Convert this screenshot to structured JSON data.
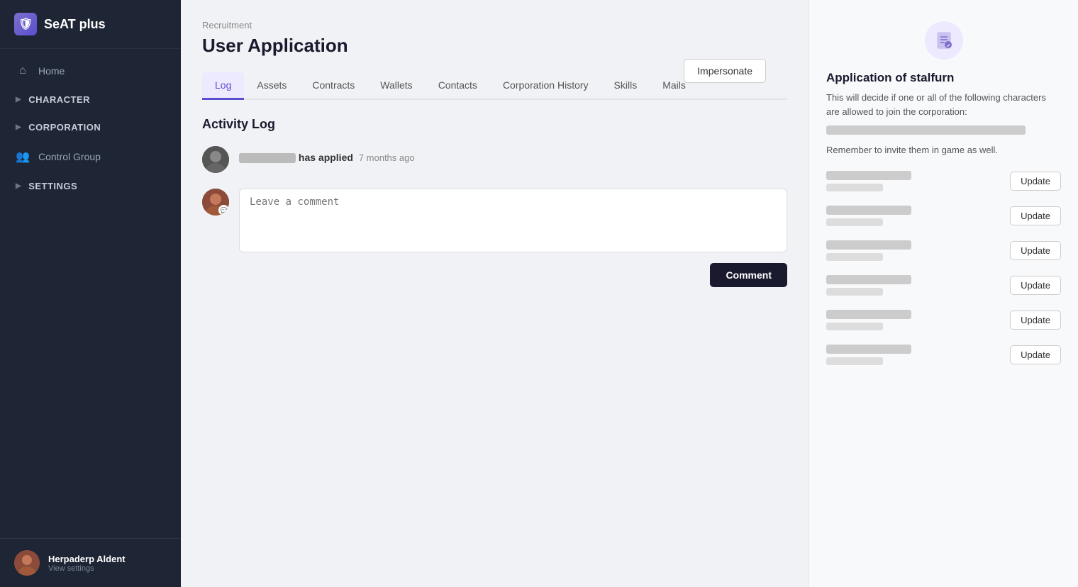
{
  "app": {
    "name": "SeAT plus",
    "logo_icon": "🛡"
  },
  "sidebar": {
    "nav_items": [
      {
        "id": "home",
        "label": "Home",
        "icon": "⌂",
        "type": "link"
      },
      {
        "id": "character",
        "label": "CHARACTER",
        "icon": "▶",
        "type": "section"
      },
      {
        "id": "corporation",
        "label": "CORPORATION",
        "icon": "▶",
        "type": "section"
      },
      {
        "id": "control_group",
        "label": "Control Group",
        "icon": "👥",
        "type": "link"
      },
      {
        "id": "settings",
        "label": "SETTINGS",
        "icon": "▶",
        "type": "section"
      }
    ],
    "footer": {
      "username": "Herpaderp Aldent",
      "view_settings": "View settings"
    }
  },
  "breadcrumb": "Recruitment",
  "page_title": "User Application",
  "impersonate_label": "Impersonate",
  "tabs": [
    {
      "id": "log",
      "label": "Log",
      "active": true
    },
    {
      "id": "assets",
      "label": "Assets",
      "active": false
    },
    {
      "id": "contracts",
      "label": "Contracts",
      "active": false
    },
    {
      "id": "wallets",
      "label": "Wallets",
      "active": false
    },
    {
      "id": "contacts",
      "label": "Contacts",
      "active": false
    },
    {
      "id": "corporation_history",
      "label": "Corporation History",
      "active": false
    },
    {
      "id": "skills",
      "label": "Skills",
      "active": false
    },
    {
      "id": "mails",
      "label": "Mails",
      "active": false
    }
  ],
  "activity_log": {
    "section_title": "Activity Log",
    "entries": [
      {
        "id": 1,
        "user_blurred": true,
        "action": "has applied",
        "time": "7 months ago"
      }
    ]
  },
  "comment": {
    "placeholder": "Leave a comment",
    "submit_label": "Comment"
  },
  "right_panel": {
    "title": "Application of stalfurn",
    "description": "This will decide if one or all of the following characters are allowed to join the corporation:",
    "note": "Remember to invite them in game as well.",
    "characters": [
      {
        "id": 1
      },
      {
        "id": 2
      },
      {
        "id": 3
      },
      {
        "id": 4
      },
      {
        "id": 5
      },
      {
        "id": 6
      }
    ],
    "update_label": "Update"
  }
}
